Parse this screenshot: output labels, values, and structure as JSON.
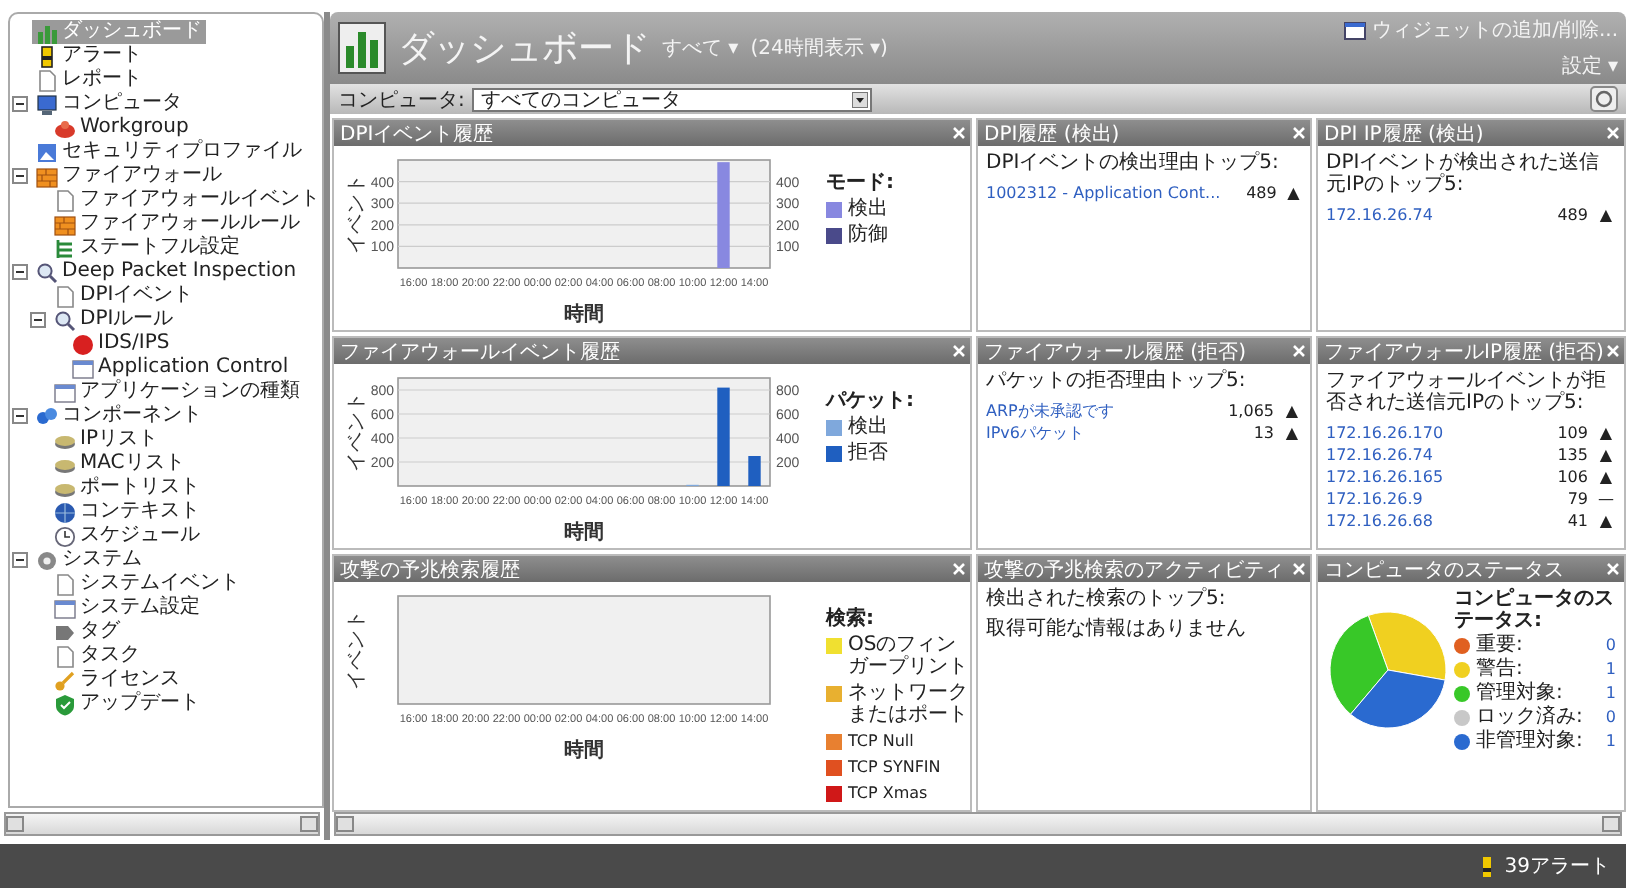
{
  "sidebar": {
    "items": [
      {
        "label": "ダッシュボード",
        "selected": true
      },
      {
        "label": "アラート",
        "selected": false
      },
      {
        "label": "レポート",
        "selected": false
      },
      {
        "label": "コンピュータ",
        "selected": false,
        "expanded": true,
        "children": [
          {
            "label": "Workgroup",
            "selected": false
          }
        ]
      },
      {
        "label": "セキュリティプロファイル",
        "selected": false
      },
      {
        "label": "ファイアウォール",
        "selected": false,
        "expanded": true,
        "children": [
          {
            "label": "ファイアウォールイベント",
            "selected": false
          },
          {
            "label": "ファイアウォールルール",
            "selected": false
          },
          {
            "label": "ステートフル設定",
            "selected": false
          }
        ]
      },
      {
        "label": "Deep Packet Inspection",
        "selected": false,
        "expanded": true,
        "children": [
          {
            "label": "DPIイベント",
            "selected": false
          },
          {
            "label": "DPIルール",
            "selected": false,
            "expanded": true,
            "children": [
              {
                "label": "IDS/IPS",
                "selected": false
              },
              {
                "label": "Application Control",
                "selected": false
              }
            ]
          },
          {
            "label": "アプリケーションの種類",
            "selected": false
          }
        ]
      },
      {
        "label": "コンポーネント",
        "selected": false,
        "expanded": true,
        "children": [
          {
            "label": "IPリスト",
            "selected": false
          },
          {
            "label": "MACリスト",
            "selected": false
          },
          {
            "label": "ポートリスト",
            "selected": false
          },
          {
            "label": "コンテキスト",
            "selected": false
          },
          {
            "label": "スケジュール",
            "selected": false
          }
        ]
      },
      {
        "label": "システム",
        "selected": false,
        "expanded": true,
        "children": [
          {
            "label": "システムイベント",
            "selected": false
          },
          {
            "label": "システム設定",
            "selected": false
          },
          {
            "label": "タグ",
            "selected": false
          },
          {
            "label": "タスク",
            "selected": false
          },
          {
            "label": "ライセンス",
            "selected": false
          },
          {
            "label": "アップデート",
            "selected": false
          }
        ]
      }
    ]
  },
  "header": {
    "title": "ダッシュボード",
    "view_menu": "すべて ▾",
    "period_menu": "(24時間表示 ▾)",
    "add_widgets": "ウィジェットの追加/削除...",
    "settings_menu": "設定 ▾"
  },
  "filter": {
    "label": "コンピュータ:",
    "value": "すべてのコンピュータ"
  },
  "widgets": [
    {
      "kind": "chart",
      "title": "DPIイベント履歴",
      "legend_title": "モード:",
      "right_axis_ticks": [
        "400",
        "300",
        "200",
        "100"
      ],
      "chart_data": {
        "type": "bar",
        "xlabel": "時間",
        "ylabel": "イベント",
        "ylim": [
          0,
          500
        ],
        "yticks": [
          100,
          200,
          300,
          400
        ],
        "grid": true,
        "categories": [
          "16:00",
          "18:00",
          "20:00",
          "22:00",
          "00:00",
          "02:00",
          "04:00",
          "06:00",
          "08:00",
          "10:00",
          "12:00",
          "14:00"
        ],
        "series": [
          {
            "name": "検出",
            "color": "#8888e0",
            "values": [
              0,
              0,
              0,
              0,
              0,
              0,
              0,
              0,
              0,
              0,
              490,
              0
            ]
          },
          {
            "name": "防御",
            "color": "#4a4a8a",
            "values": [
              0,
              0,
              0,
              0,
              0,
              0,
              0,
              0,
              0,
              0,
              0,
              0
            ]
          }
        ]
      }
    },
    {
      "kind": "list",
      "title": "DPI履歴 (検出)",
      "heading": "DPIイベントの検出理由トップ5:",
      "rows": [
        {
          "label": "1002312 - Application Cont...",
          "count": "489",
          "trend": "▲"
        }
      ]
    },
    {
      "kind": "list",
      "title": "DPI IP履歴 (検出)",
      "heading": "DPIイベントが検出された送信元IPのトップ5:",
      "rows": [
        {
          "label": "172.16.26.74",
          "count": "489",
          "trend": "▲"
        }
      ]
    },
    {
      "kind": "chart",
      "title": "ファイアウォールイベント履歴",
      "legend_title": "パケット:",
      "right_axis_ticks": [
        "800",
        "600",
        "400",
        "200"
      ],
      "chart_data": {
        "type": "bar",
        "xlabel": "時間",
        "ylabel": "イベント",
        "ylim": [
          0,
          900
        ],
        "yticks": [
          200,
          400,
          600,
          800
        ],
        "grid": true,
        "categories": [
          "16:00",
          "18:00",
          "20:00",
          "22:00",
          "00:00",
          "02:00",
          "04:00",
          "06:00",
          "08:00",
          "10:00",
          "12:00",
          "14:00"
        ],
        "series": [
          {
            "name": "検出",
            "color": "#7fa8dc",
            "values": [
              0,
              0,
              0,
              0,
              0,
              0,
              0,
              0,
              0,
              10,
              0,
              0
            ]
          },
          {
            "name": "拒否",
            "color": "#1f5fc0",
            "values": [
              0,
              0,
              0,
              0,
              0,
              0,
              0,
              0,
              0,
              0,
              820,
              250
            ]
          }
        ]
      }
    },
    {
      "kind": "list",
      "title": "ファイアウォール履歴 (拒否)",
      "heading": "パケットの拒否理由トップ5:",
      "rows": [
        {
          "label": "ARPが未承認です",
          "count": "1,065",
          "trend": "▲"
        },
        {
          "label": "IPv6パケット",
          "count": "13",
          "trend": "▲"
        }
      ]
    },
    {
      "kind": "list",
      "title": "ファイアウォールIP履歴 (拒否)",
      "heading": "ファイアウォールイベントが拒否された送信元IPのトップ5:",
      "rows": [
        {
          "label": "172.16.26.170",
          "count": "109",
          "trend": "▲"
        },
        {
          "label": "172.16.26.74",
          "count": "135",
          "trend": "▲"
        },
        {
          "label": "172.16.26.165",
          "count": "106",
          "trend": "▲"
        },
        {
          "label": "172.16.26.9",
          "count": "79",
          "trend": "—"
        },
        {
          "label": "172.16.26.68",
          "count": "41",
          "trend": "▲"
        }
      ]
    },
    {
      "kind": "plot",
      "title": "攻撃の予兆検索履歴",
      "ylabel": "イベント",
      "xlabel": "時間",
      "xticks": [
        "16:00",
        "18:00",
        "20:00",
        "22:00",
        "00:00",
        "02:00",
        "04:00",
        "06:00",
        "08:00",
        "10:00",
        "12:00",
        "14:00"
      ],
      "legend_title": "検索:",
      "legend": [
        {
          "label": "OSのフィンガープリント",
          "color": "#f0e030"
        },
        {
          "label": "ネットワークまたはポート",
          "color": "#e8b030"
        },
        {
          "label": "TCP Null",
          "color": "#e88030"
        },
        {
          "label": "TCP SYNFIN",
          "color": "#e05020"
        },
        {
          "label": "TCP Xmas",
          "color": "#d01818"
        }
      ]
    },
    {
      "kind": "text",
      "title": "攻撃の予兆検索のアクティビティ",
      "heading": "検出された検索のトップ5:",
      "message": "取得可能な情報はありません"
    },
    {
      "kind": "pie",
      "title": "コンピュータのステータス",
      "legend": [
        {
          "label": "重要:",
          "count": "0",
          "color": "#e06020"
        },
        {
          "label": "警告:",
          "count": "1",
          "color": "#f0d020"
        },
        {
          "label": "管理対象:",
          "count": "1",
          "color": "#38c828"
        },
        {
          "label": "ロック済み:",
          "count": "0",
          "color": "#c8c8c8"
        },
        {
          "label": "非管理対象:",
          "count": "1",
          "color": "#2a6ad0"
        }
      ],
      "chart_data": {
        "type": "pie",
        "title": "コンピュータのステータス:",
        "values": [
          0,
          33.3,
          33.3,
          0,
          33.4
        ]
      }
    }
  ],
  "status_bar": {
    "alerts": "39アラート"
  }
}
